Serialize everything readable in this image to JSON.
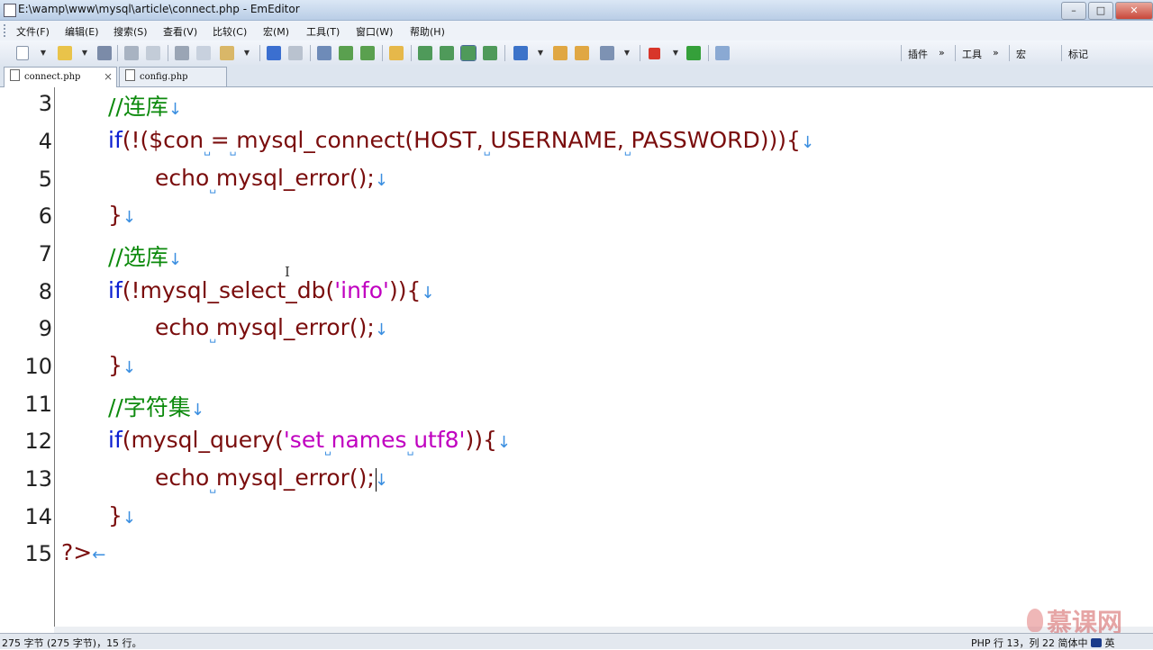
{
  "window": {
    "title": "E:\\wamp\\www\\mysql\\article\\connect.php - EmEditor",
    "controls": {
      "minimize": "–",
      "maximize": "□",
      "close": "✕"
    }
  },
  "menu": [
    "文件(F)",
    "编辑(E)",
    "搜索(S)",
    "查看(V)",
    "比较(C)",
    "宏(M)",
    "工具(T)",
    "窗口(W)",
    "帮助(H)"
  ],
  "toolbar_right": {
    "plugins": "插件",
    "tools": "工具",
    "macros": "宏",
    "markers": "标记",
    "chevron": "»"
  },
  "tabs": [
    {
      "label": "connect.php",
      "active": true,
      "close": "×"
    },
    {
      "label": "config.php",
      "active": false
    }
  ],
  "gutter": [
    "3",
    "4",
    "5",
    "6",
    "7",
    "8",
    "9",
    "10",
    "11",
    "12",
    "13",
    "14",
    "15"
  ],
  "code": {
    "l3": {
      "comment": "//连库"
    },
    "l4": {
      "kw": "if",
      "a": "(!($con",
      "b": "=",
      "c": "mysql_connect(HOST,",
      "d": "USERNAME,",
      "e": "PASSWORD))){"
    },
    "l5": {
      "a": "echo",
      "b": "mysql_error();"
    },
    "l6": {
      "a": "}"
    },
    "l7": {
      "comment": "//选库"
    },
    "l8": {
      "kw": "if",
      "a": "(!mysql_select_db(",
      "str": "'info'",
      "b": ")){"
    },
    "l9": {
      "a": "echo",
      "b": "mysql_error();"
    },
    "l10": {
      "a": "}"
    },
    "l11": {
      "comment": "//字符集"
    },
    "l12": {
      "kw": "if",
      "a": "(mysql_query(",
      "s1": "'set",
      "s2": "names",
      "s3": "utf8'",
      "b": ")){"
    },
    "l13": {
      "a": "echo",
      "b": "mysql_error();"
    },
    "l14": {
      "a": "}"
    },
    "l15": {
      "a": "?>"
    },
    "marks": {
      "space": "␣",
      "eol": "↓",
      "eof": "←",
      "ibeam": "I"
    }
  },
  "status": {
    "left": "275 字节 (275 字节)，15 行。",
    "right": "PHP  行 13，列 22  简体中",
    "ime": "英"
  },
  "watermark": "慕课网",
  "colors": {
    "keyword": "#0b1fd1",
    "comment": "#0d8a0d",
    "string": "#c000c0",
    "text": "#7a0d0d",
    "whitespace": "#3a8ee0"
  }
}
